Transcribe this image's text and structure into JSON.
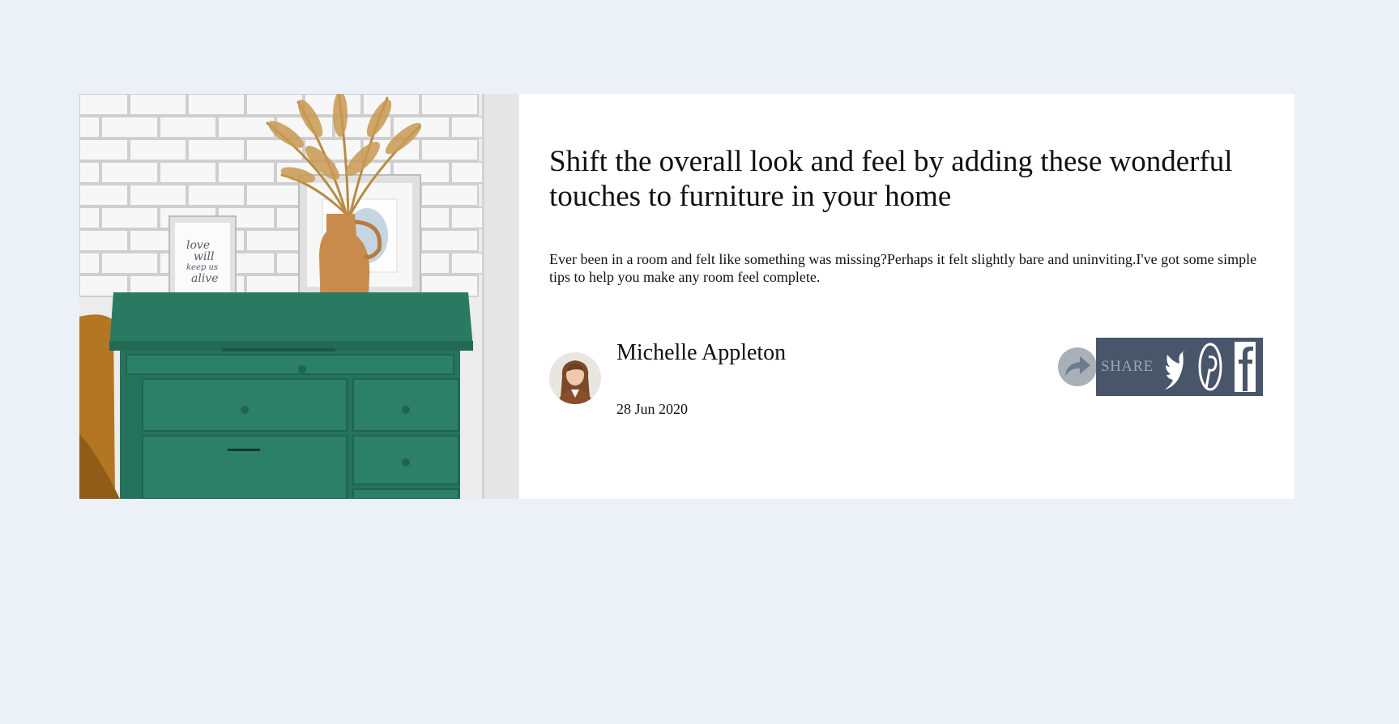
{
  "article": {
    "title": "Shift the overall look and feel by adding these wonderful touches to furniture in your home",
    "excerpt": "Ever been in a room and felt like something was missing?Perhaps it felt slightly bare and uninviting.I've got some simple tips to help you make any room feel complete.",
    "image_alt": "Green dresser with vase and framed prints"
  },
  "author": {
    "name": "Michelle Appleton",
    "date": "28 Jun 2020"
  },
  "share": {
    "label": "SHARE",
    "networks": [
      "twitter-icon",
      "pinterest-icon",
      "facebook-icon"
    ]
  },
  "frame_text": [
    "love",
    "will",
    "keep us",
    "alive"
  ],
  "colors": {
    "background": "#ecf1f8",
    "card": "#ffffff",
    "share_bar": "#48556a",
    "share_circle": "#a9b0b7",
    "dresser": "#2a7a62"
  }
}
